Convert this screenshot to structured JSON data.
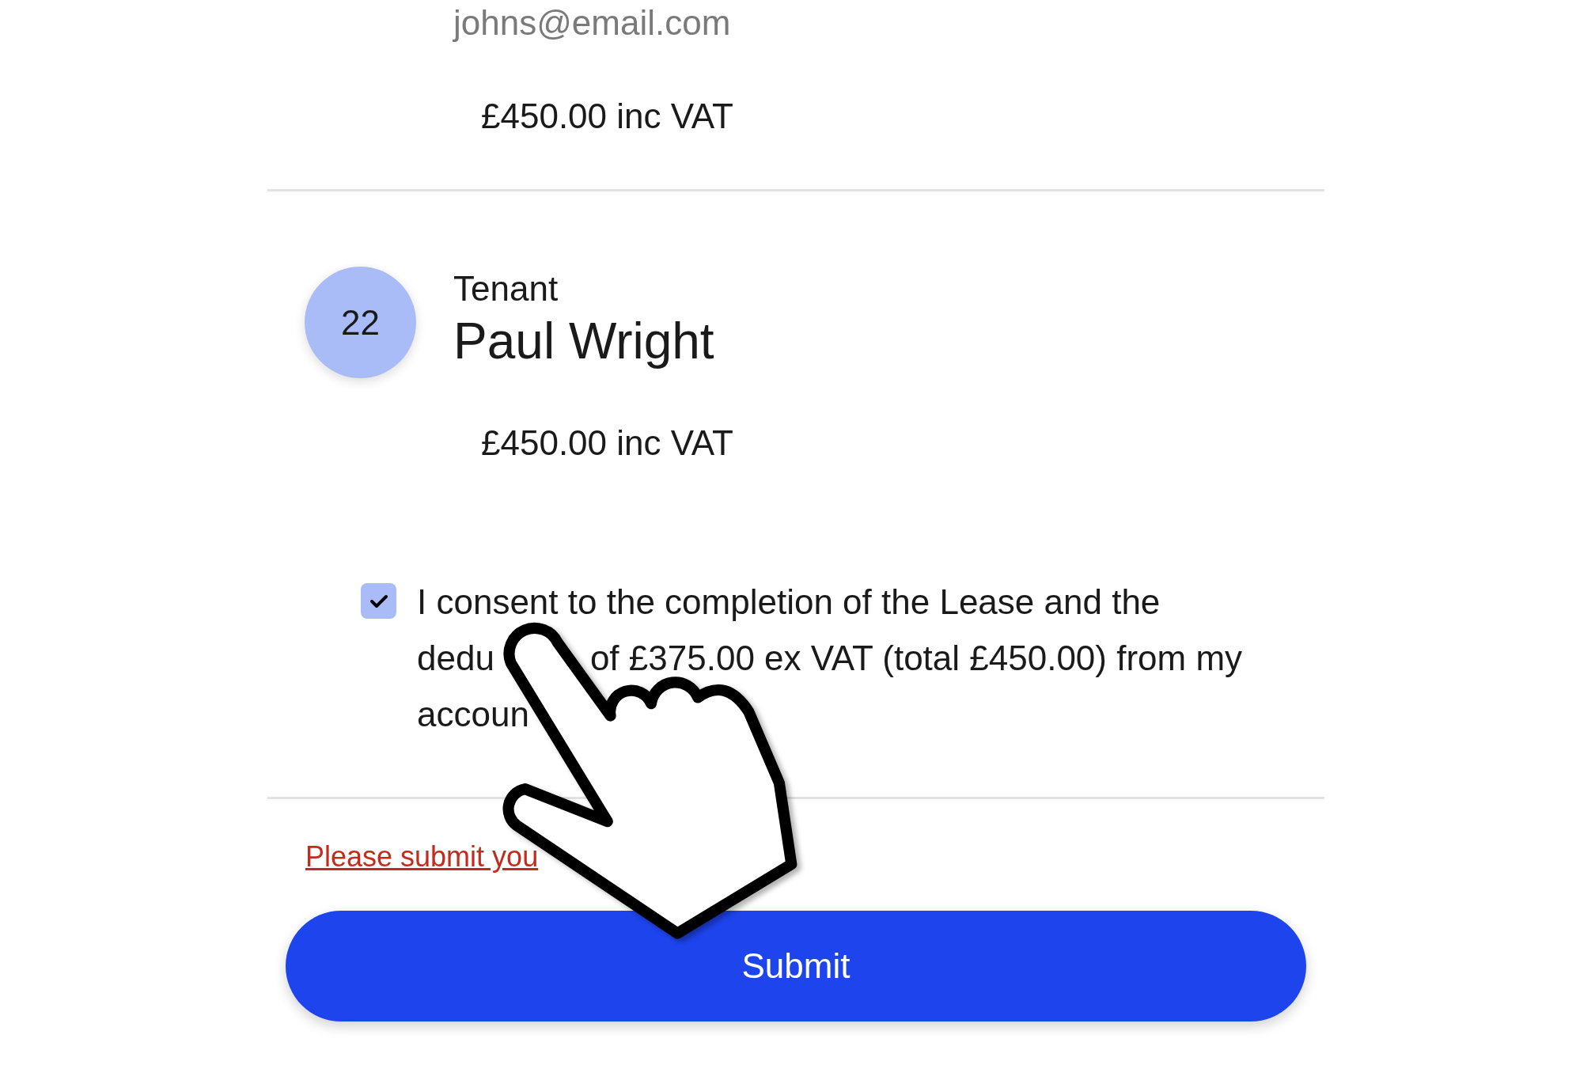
{
  "previous_party": {
    "email": "johns@email.com",
    "amount": "£450.00 inc VAT"
  },
  "party": {
    "badge": "22",
    "role": "Tenant",
    "name": "Paul Wright",
    "amount": "£450.00 inc VAT"
  },
  "consent": {
    "checked": true,
    "lines": [
      {
        "parts": [
          "I consent to the completion of the Lease and the"
        ]
      },
      {
        "parts": [
          "dedu",
          "of £375.00 ex VAT (total £450.00) from my"
        ]
      },
      {
        "parts": [
          "accoun"
        ]
      }
    ]
  },
  "error_link": "Please submit you",
  "submit_button": "Submit"
}
